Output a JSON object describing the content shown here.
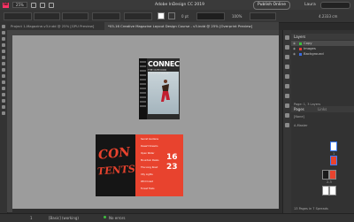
{
  "app": {
    "logo": "Id",
    "zoom": "25%",
    "title": "Adobe InDesign CC 2019",
    "publish_label": "Publish Online",
    "user": "Laura"
  },
  "control": {
    "stroke_weight": "0 pt",
    "zoom_field": "100%",
    "width_field": "4.2333 cm"
  },
  "tabs": [
    {
      "label": "Project 1-Magazine-v3.indd @ 25% [GPU Preview]"
    },
    {
      "label": "*05-16 Creative Magazine Layout Design Course - v3.indd @ 25% [Overprint Preview]"
    }
  ],
  "spread1": {
    "title": "CONNECT",
    "subtitle": "THE OUTDOOR LIFESTYLE ISSUE"
  },
  "spread2": {
    "graffiti_1": "CON",
    "graffiti_2": "TENTS",
    "items": [
      "Secret Gardens",
      "Desert Dreams",
      "Open Water",
      "Mountain Peaks",
      "The Long Road",
      "City Lights",
      "Wild Coast",
      "Forest Trails"
    ],
    "big_1": "16",
    "big_2": "23"
  },
  "status": {
    "page": "1",
    "mode": "[Basic] (working)",
    "preflight": "No errors"
  },
  "layers_panel": {
    "title": "Layers",
    "layers": [
      {
        "name": "Copy",
        "color": "#3cbf3c",
        "selected": true
      },
      {
        "name": "Images",
        "color": "#e33a3a",
        "selected": false
      },
      {
        "name": "Background",
        "color": "#3a6ce3",
        "selected": false
      }
    ],
    "footer": "Page: 1, 3 Layers"
  },
  "pages_panel": {
    "title": "Pages",
    "tab2": "Links",
    "none": "[None]",
    "master": "A-Master",
    "spread_labels": [
      "1",
      "2-3"
    ],
    "footer": "13 Pages in 7 Spreads"
  },
  "colors": {
    "accent": "#e8432e",
    "canvas": "#9c9c9c"
  }
}
